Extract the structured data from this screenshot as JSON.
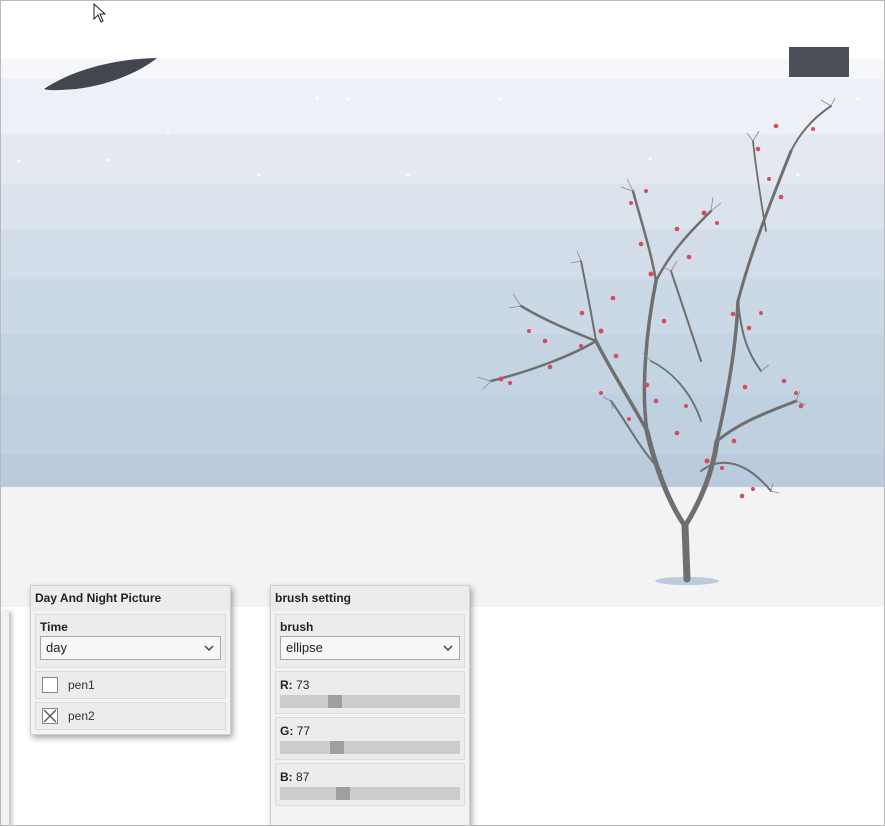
{
  "scene": {
    "sky_colors": [
      "#f6f7fb",
      "#b9cbdd"
    ],
    "ground_color": "#f4f3f4",
    "berry_color": "#d64c5a",
    "branch_color": "#6f6f70"
  },
  "panels": {
    "day_night": {
      "title": "Day And Night Picture",
      "time_label": "Time",
      "time_value": "day",
      "pen1_label": "pen1",
      "pen1_checked": false,
      "pen2_label": "pen2",
      "pen2_checked": true
    },
    "brush": {
      "title": "brush setting",
      "brush_label": "brush",
      "brush_value": "ellipse",
      "r_label": "R:",
      "r_value": "73",
      "r_level": 0.29,
      "g_label": "G:",
      "g_value": "77",
      "g_level": 0.3,
      "b_label": "B:",
      "b_value": "87",
      "b_level": 0.34
    }
  },
  "icons": {
    "cursor": "arrow-cursor-icon",
    "dropdown": "chevron-down-icon",
    "check": "x-check-icon"
  }
}
